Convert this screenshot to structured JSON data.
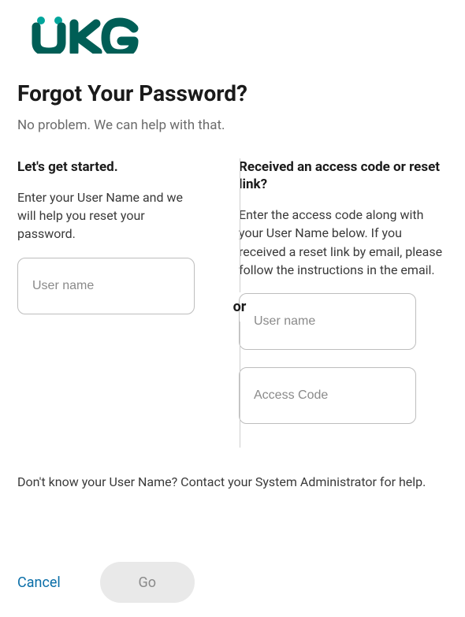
{
  "brand": {
    "name": "UKG"
  },
  "page": {
    "title": "Forgot Your Password?",
    "subtitle": "No problem. We can help with that."
  },
  "left": {
    "heading": "Let's get started.",
    "text": "Enter your User Name and we will help you reset your password.",
    "username_placeholder": "User name"
  },
  "divider": {
    "or": "or"
  },
  "right": {
    "heading": "Received an access code or reset link?",
    "text": "Enter the access code along with your User Name below. If you received a reset link by email, please follow the instructions in the email.",
    "username_placeholder": "User name",
    "accesscode_placeholder": "Access Code"
  },
  "helper": "Don't know your User Name? Contact your System Administrator for help.",
  "footer": {
    "cancel": "Cancel",
    "go": "Go"
  }
}
